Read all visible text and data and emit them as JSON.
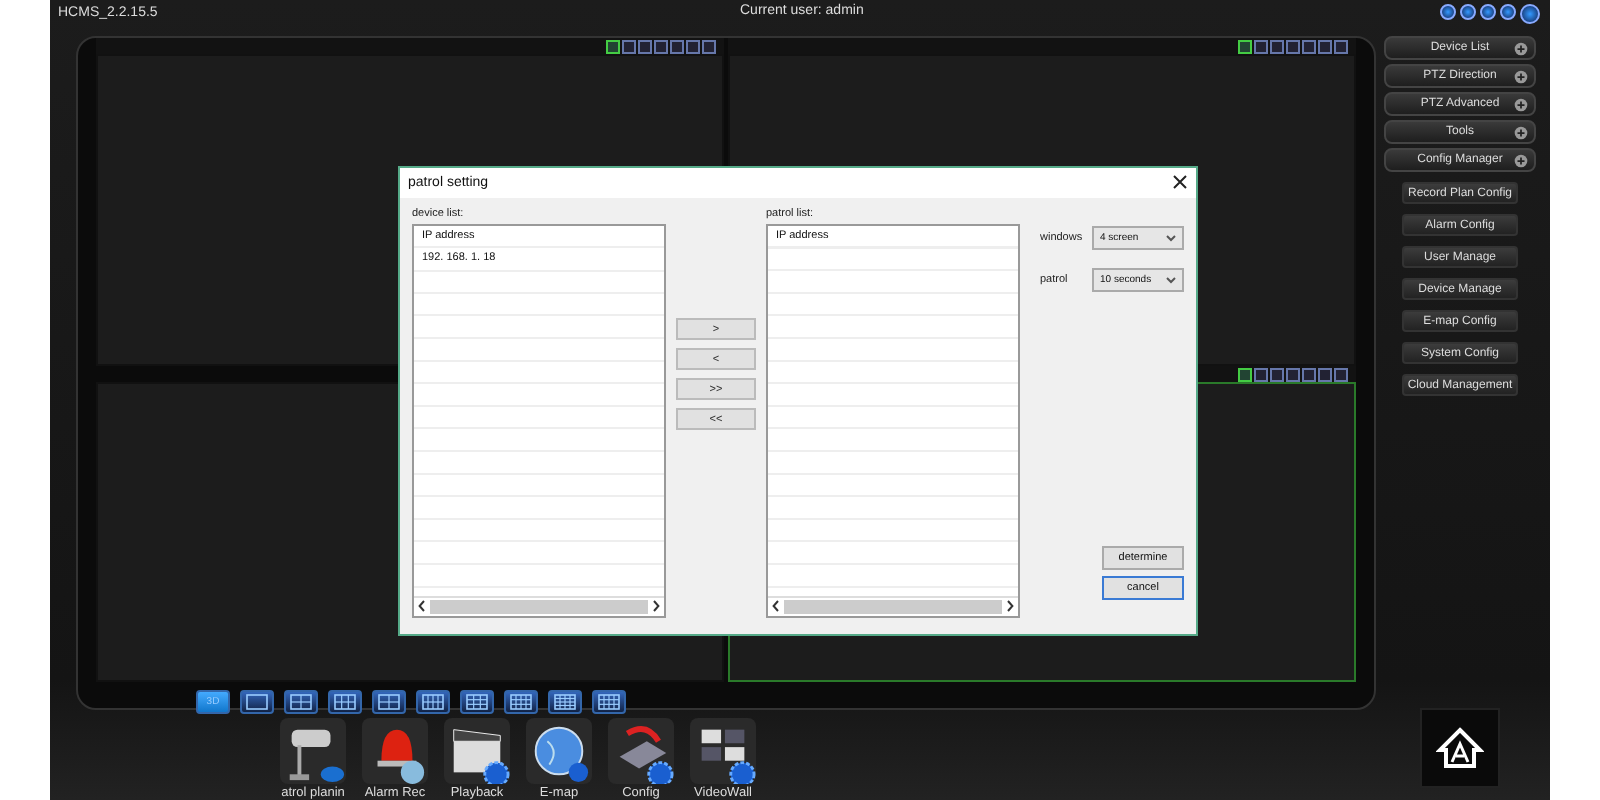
{
  "app": {
    "title": "HCMS_2.2.15.5",
    "user": "Current user: admin"
  },
  "panes": [
    {
      "selected": false,
      "toolbar": true
    },
    {
      "selected": false,
      "toolbar": true
    },
    {
      "selected": false
    },
    {
      "selected": true,
      "toolbar": true
    }
  ],
  "layout_modes": [
    {
      "kind": "threed",
      "label": "3D",
      "selected": true
    },
    {
      "kind": "one",
      "selected": false
    },
    {
      "kind": "four",
      "selected": false
    },
    {
      "kind": "six",
      "selected": false
    },
    {
      "kind": "four",
      "selected": false
    },
    {
      "kind": "eight",
      "selected": false
    },
    {
      "kind": "nine",
      "selected": false
    },
    {
      "kind": "ten",
      "selected": false
    },
    {
      "kind": "sixteen",
      "selected": false
    },
    {
      "kind": "thirteen",
      "selected": false
    }
  ],
  "sidebar": {
    "sections": [
      "Device List",
      "PTZ Direction",
      "PTZ Advanced",
      "Tools",
      "Config Manager"
    ],
    "config_items": [
      "Record Plan Config",
      "Alarm Config",
      "User Manage",
      "Device Manage",
      "E-map Config",
      "System Config",
      "Cloud Management"
    ]
  },
  "dock": [
    {
      "kind": "camera",
      "label": "atrol planin"
    },
    {
      "kind": "alarm",
      "label": "Alarm Rec"
    },
    {
      "kind": "playback",
      "label": "Playback"
    },
    {
      "kind": "emap",
      "label": "E-map"
    },
    {
      "kind": "config",
      "label": "Config"
    },
    {
      "kind": "videowall",
      "label": "VideoWall"
    }
  ],
  "dialog": {
    "title": "patrol setting",
    "device_list": {
      "label": "device list:",
      "header": "IP address",
      "rows": [
        "192. 168. 1. 18"
      ]
    },
    "transfer_buttons": [
      ">",
      "<",
      ">>",
      "<<"
    ],
    "patrol_list": {
      "label": "patrol list:",
      "header": "IP address"
    },
    "windows": {
      "label": "windows",
      "value": "4 screen"
    },
    "patrol": {
      "label": "patrol",
      "value": "10 seconds"
    },
    "buttons": [
      {
        "label": "determine",
        "focused": false
      },
      {
        "label": "cancel",
        "focused": true
      }
    ]
  }
}
